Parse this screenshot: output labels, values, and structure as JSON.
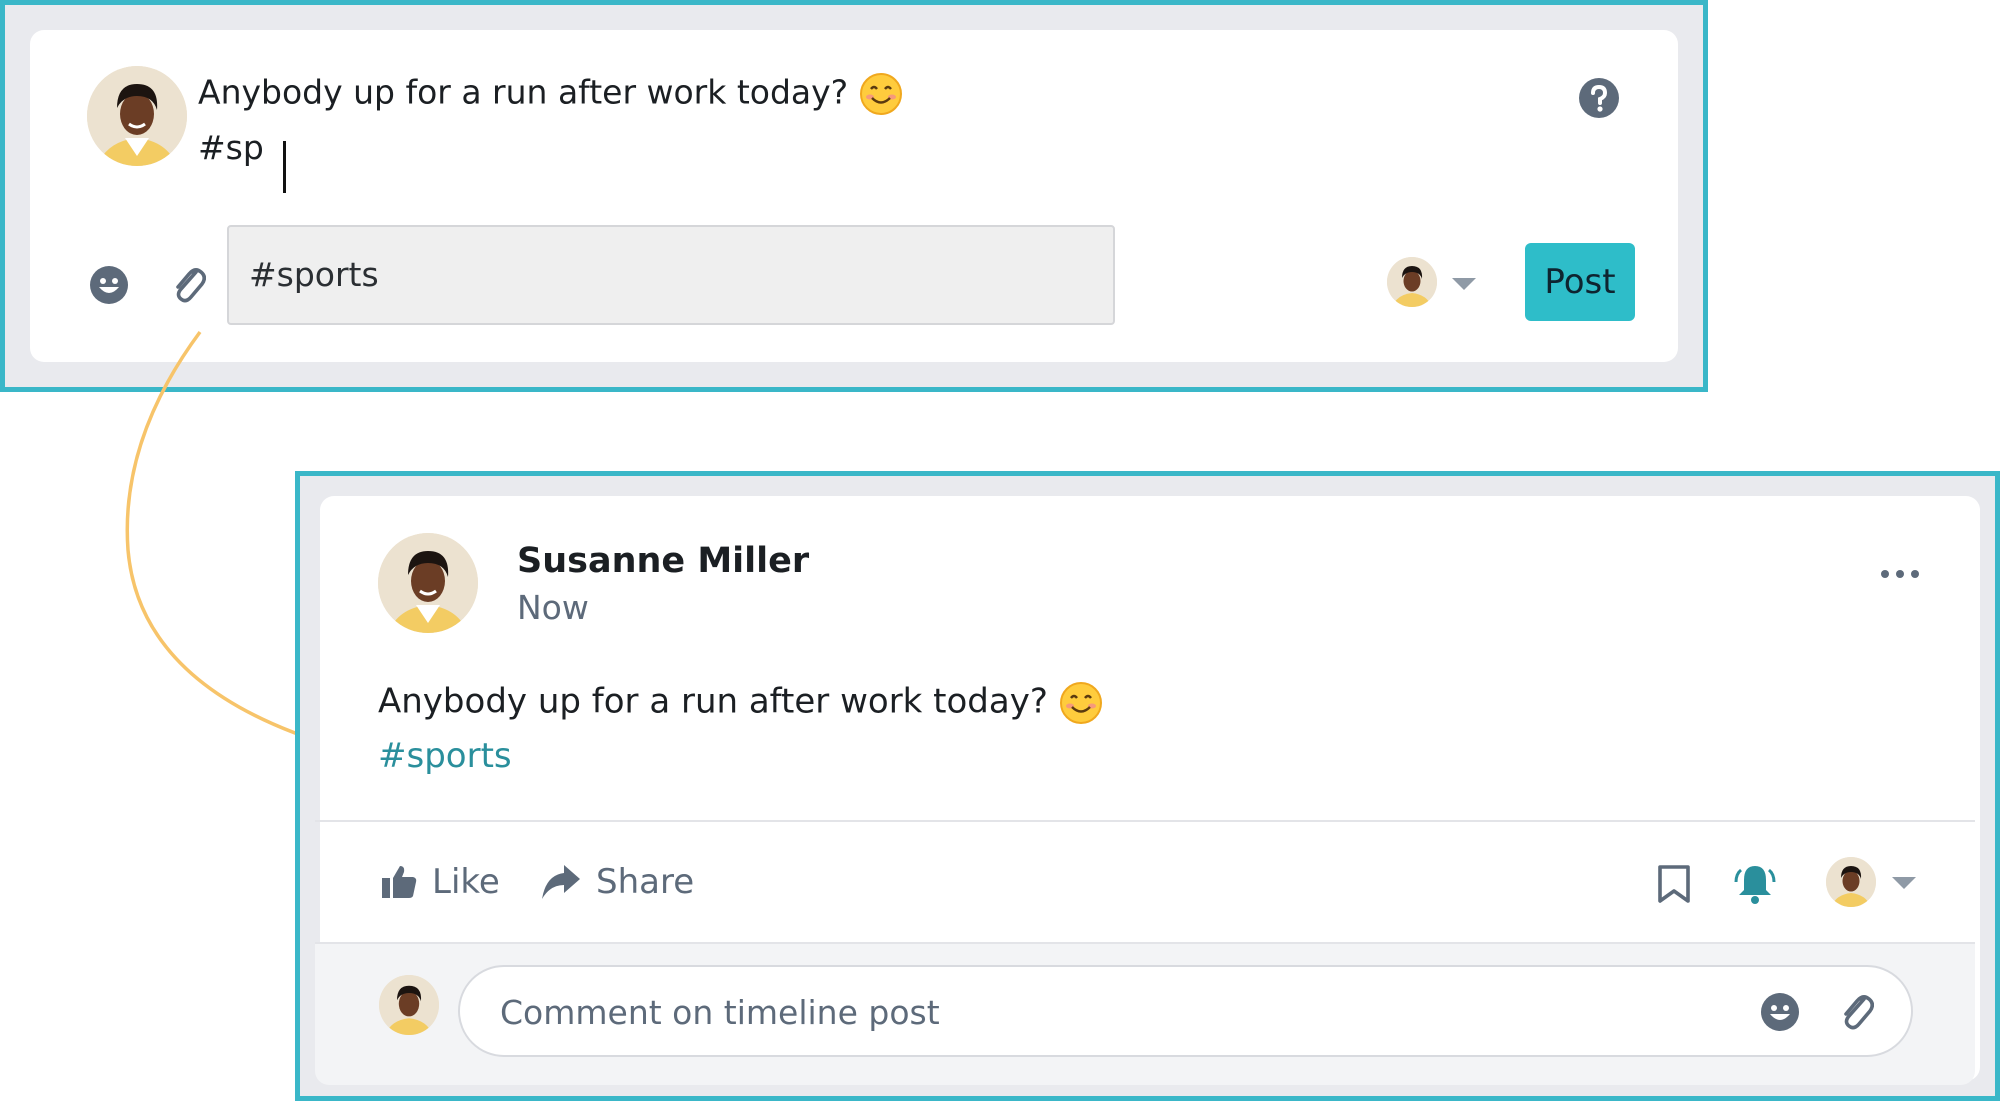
{
  "composer": {
    "text_line1": "Anybody up for a run after work today?",
    "text_line2": "#sp",
    "suggestion": "#sports",
    "post_label": "Post"
  },
  "post": {
    "author": "Susanne Miller",
    "time": "Now",
    "body": "Anybody up for a run after work today?",
    "hashtag": "#sports",
    "like_label": "Like",
    "share_label": "Share"
  },
  "comment": {
    "placeholder": "Comment on timeline post"
  },
  "colors": {
    "frame": "#3ab7c8",
    "post_button": "#2ebdc9",
    "hashtag": "#2a8f9c",
    "arrow": "#f7c46a",
    "bell": "#2a8f9c"
  },
  "icons": [
    "smiley-icon",
    "paperclip-icon",
    "help-icon",
    "chevron-down-icon",
    "more-icon",
    "thumbs-up-icon",
    "share-arrow-icon",
    "bookmark-icon",
    "bell-icon"
  ]
}
